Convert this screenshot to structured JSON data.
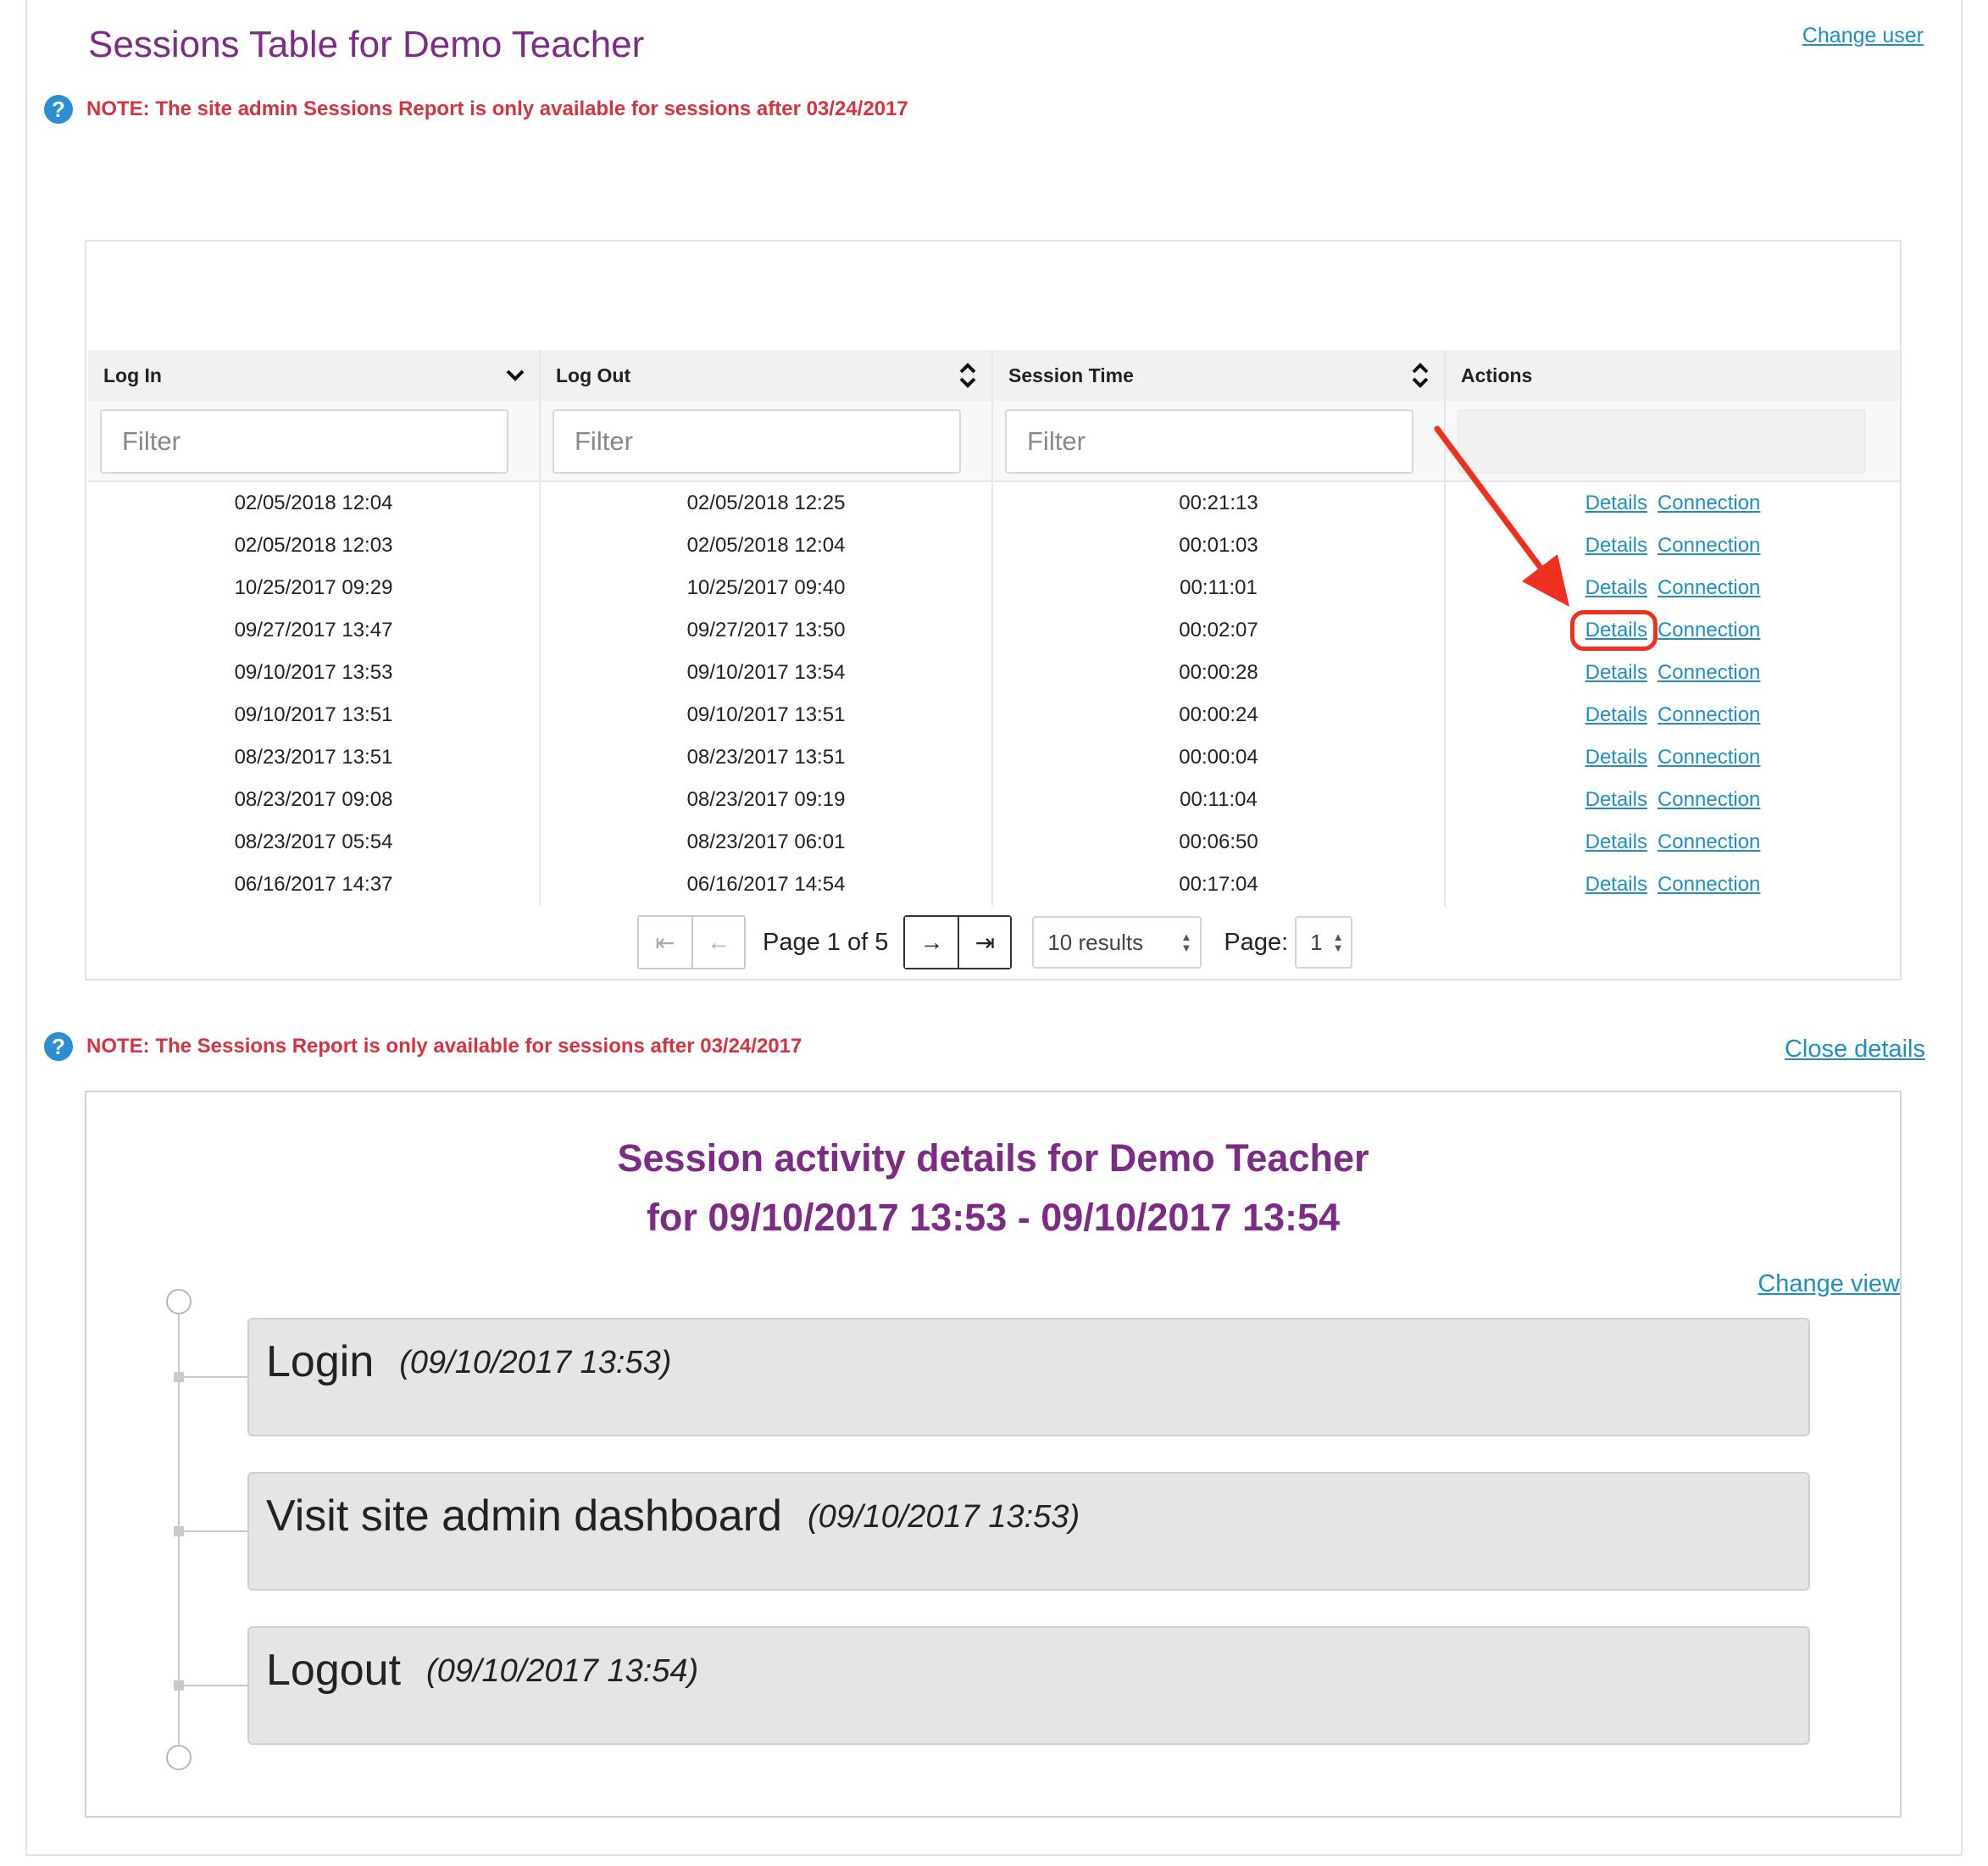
{
  "header": {
    "title": "Sessions Table for Demo Teacher",
    "change_user": "Change user",
    "note": "NOTE: The site admin Sessions Report is only available for sessions after 03/24/2017"
  },
  "table": {
    "columns": [
      "Log In",
      "Log Out",
      "Session Time",
      "Actions"
    ],
    "filter_placeholder": "Filter",
    "rows": [
      {
        "login": "02/05/2018 12:04",
        "logout": "02/05/2018 12:25",
        "session_time": "00:21:13"
      },
      {
        "login": "02/05/2018 12:03",
        "logout": "02/05/2018 12:04",
        "session_time": "00:01:03"
      },
      {
        "login": "10/25/2017 09:29",
        "logout": "10/25/2017 09:40",
        "session_time": "00:11:01"
      },
      {
        "login": "09/27/2017 13:47",
        "logout": "09/27/2017 13:50",
        "session_time": "00:02:07"
      },
      {
        "login": "09/10/2017 13:53",
        "logout": "09/10/2017 13:54",
        "session_time": "00:00:28"
      },
      {
        "login": "09/10/2017 13:51",
        "logout": "09/10/2017 13:51",
        "session_time": "00:00:24"
      },
      {
        "login": "08/23/2017 13:51",
        "logout": "08/23/2017 13:51",
        "session_time": "00:00:04"
      },
      {
        "login": "08/23/2017 09:08",
        "logout": "08/23/2017 09:19",
        "session_time": "00:11:04"
      },
      {
        "login": "08/23/2017 05:54",
        "logout": "08/23/2017 06:01",
        "session_time": "00:06:50"
      },
      {
        "login": "06/16/2017 14:37",
        "logout": "06/16/2017 14:54",
        "session_time": "00:17:04"
      }
    ],
    "action_details": "Details",
    "action_connection": "Connection"
  },
  "pagination": {
    "first": "⇤",
    "prev": "←",
    "next": "→",
    "last": "⇥",
    "page_info": "Page 1 of 5",
    "results_selected": "10 results",
    "page_label": "Page:",
    "page_selected": "1"
  },
  "details": {
    "note": "NOTE: The Sessions Report is only available for sessions after 03/24/2017",
    "close_details": "Close details",
    "title_line1": "Session activity details for Demo Teacher",
    "title_line2": "for 09/10/2017 13:53 - 09/10/2017 13:54",
    "change_view": "Change view",
    "events": [
      {
        "name": "Login",
        "time": "(09/10/2017 13:53)"
      },
      {
        "name": "Visit site admin dashboard",
        "time": "(09/10/2017 13:53)"
      },
      {
        "name": "Logout",
        "time": "(09/10/2017 13:54)"
      }
    ]
  },
  "colors": {
    "title_purple": "#7d2c86",
    "note_red": "#d6333f",
    "link_blue": "#1c8fc3",
    "highlight_red": "#f0301e"
  }
}
